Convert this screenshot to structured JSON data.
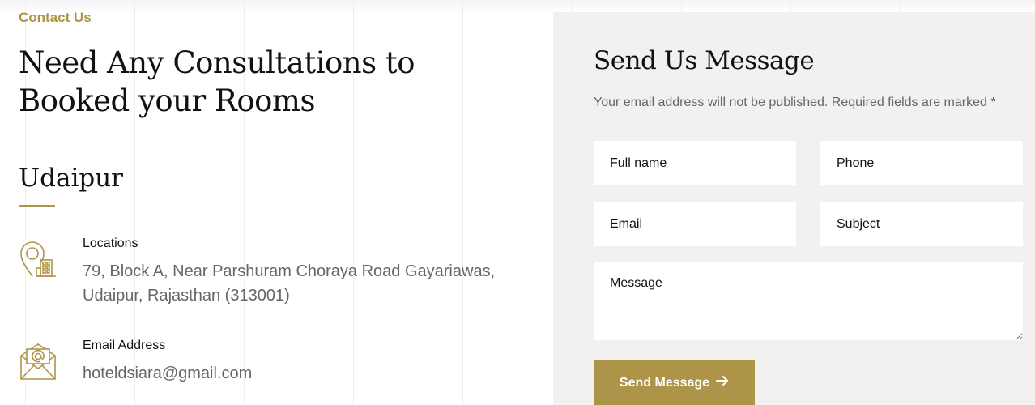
{
  "section": {
    "eyebrow": "Contact Us",
    "headline": "Need Any Consultations to Booked your Rooms",
    "city": "Udaipur"
  },
  "info": [
    {
      "icon": "location-building-icon",
      "title": "Locations",
      "text": "79, Block A, Near Parshuram Choraya Road Gayariawas, Udaipur, Rajasthan (313001)"
    },
    {
      "icon": "email-envelope-icon",
      "title": "Email Address",
      "text": "hoteldsiara@gmail.com"
    }
  ],
  "form": {
    "title": "Send Us Message",
    "note": "Your email address will not be published. Required fields are marked *",
    "fullname_placeholder": "Full name",
    "phone_placeholder": "Phone",
    "email_placeholder": "Email",
    "subject_placeholder": "Subject",
    "message_placeholder": "Message",
    "submit_label": "Send Message",
    "submit_icon": "arrow-right-icon"
  },
  "colors": {
    "accent": "#ae9448",
    "panel_bg": "#f2f1ef"
  }
}
